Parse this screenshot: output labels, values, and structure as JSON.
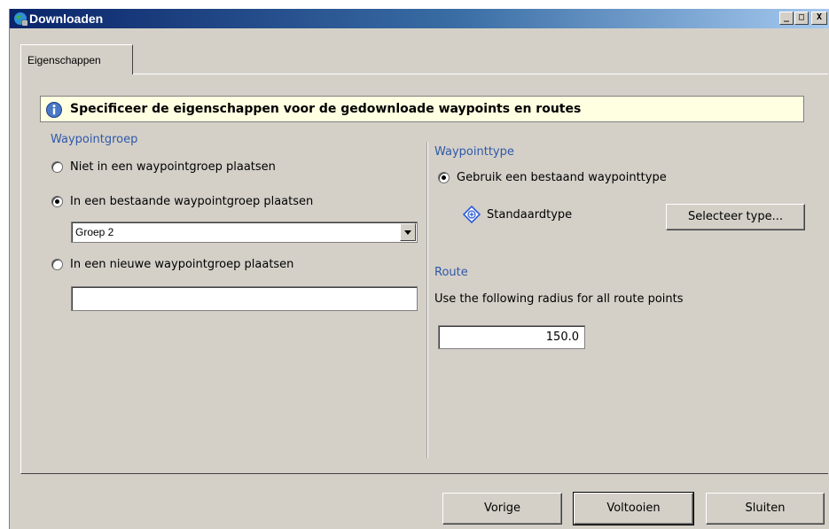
{
  "window": {
    "title": "Downloaden",
    "controls": {
      "minimize": "_",
      "maximize": "□",
      "close": "X"
    }
  },
  "tabs": [
    {
      "label": "Eigenschappen"
    }
  ],
  "banner": {
    "text": "Specificeer de eigenschappen voor de gedownloade waypoints en routes"
  },
  "waypointgroep": {
    "label": "Waypointgroep",
    "options": [
      {
        "label": "Niet in een waypointgroep plaatsen",
        "selected": false
      },
      {
        "label": "In een bestaande waypointgroep plaatsen",
        "selected": true
      },
      {
        "label": "In een nieuwe waypointgroep plaatsen",
        "selected": false
      }
    ],
    "existing_group_value": "Groep 2",
    "new_group_value": ""
  },
  "waypointtype": {
    "label": "Waypointtype",
    "option_label": "Gebruik een bestaand waypointtype",
    "type_name": "Standaardtype",
    "select_button": "Selecteer type..."
  },
  "route": {
    "label": "Route",
    "description": "Use the following radius for all route points",
    "radius_value": "150.0"
  },
  "footer": {
    "prev_button": "Vorige",
    "finish_button": "Voltooien",
    "close_button": "Sluiten"
  },
  "colors": {
    "title_gradient_start": "#0a246a",
    "section_label": "#2f58a8",
    "banner_bg": "#ffffe1",
    "dialog_bg": "#d4d0c8"
  }
}
